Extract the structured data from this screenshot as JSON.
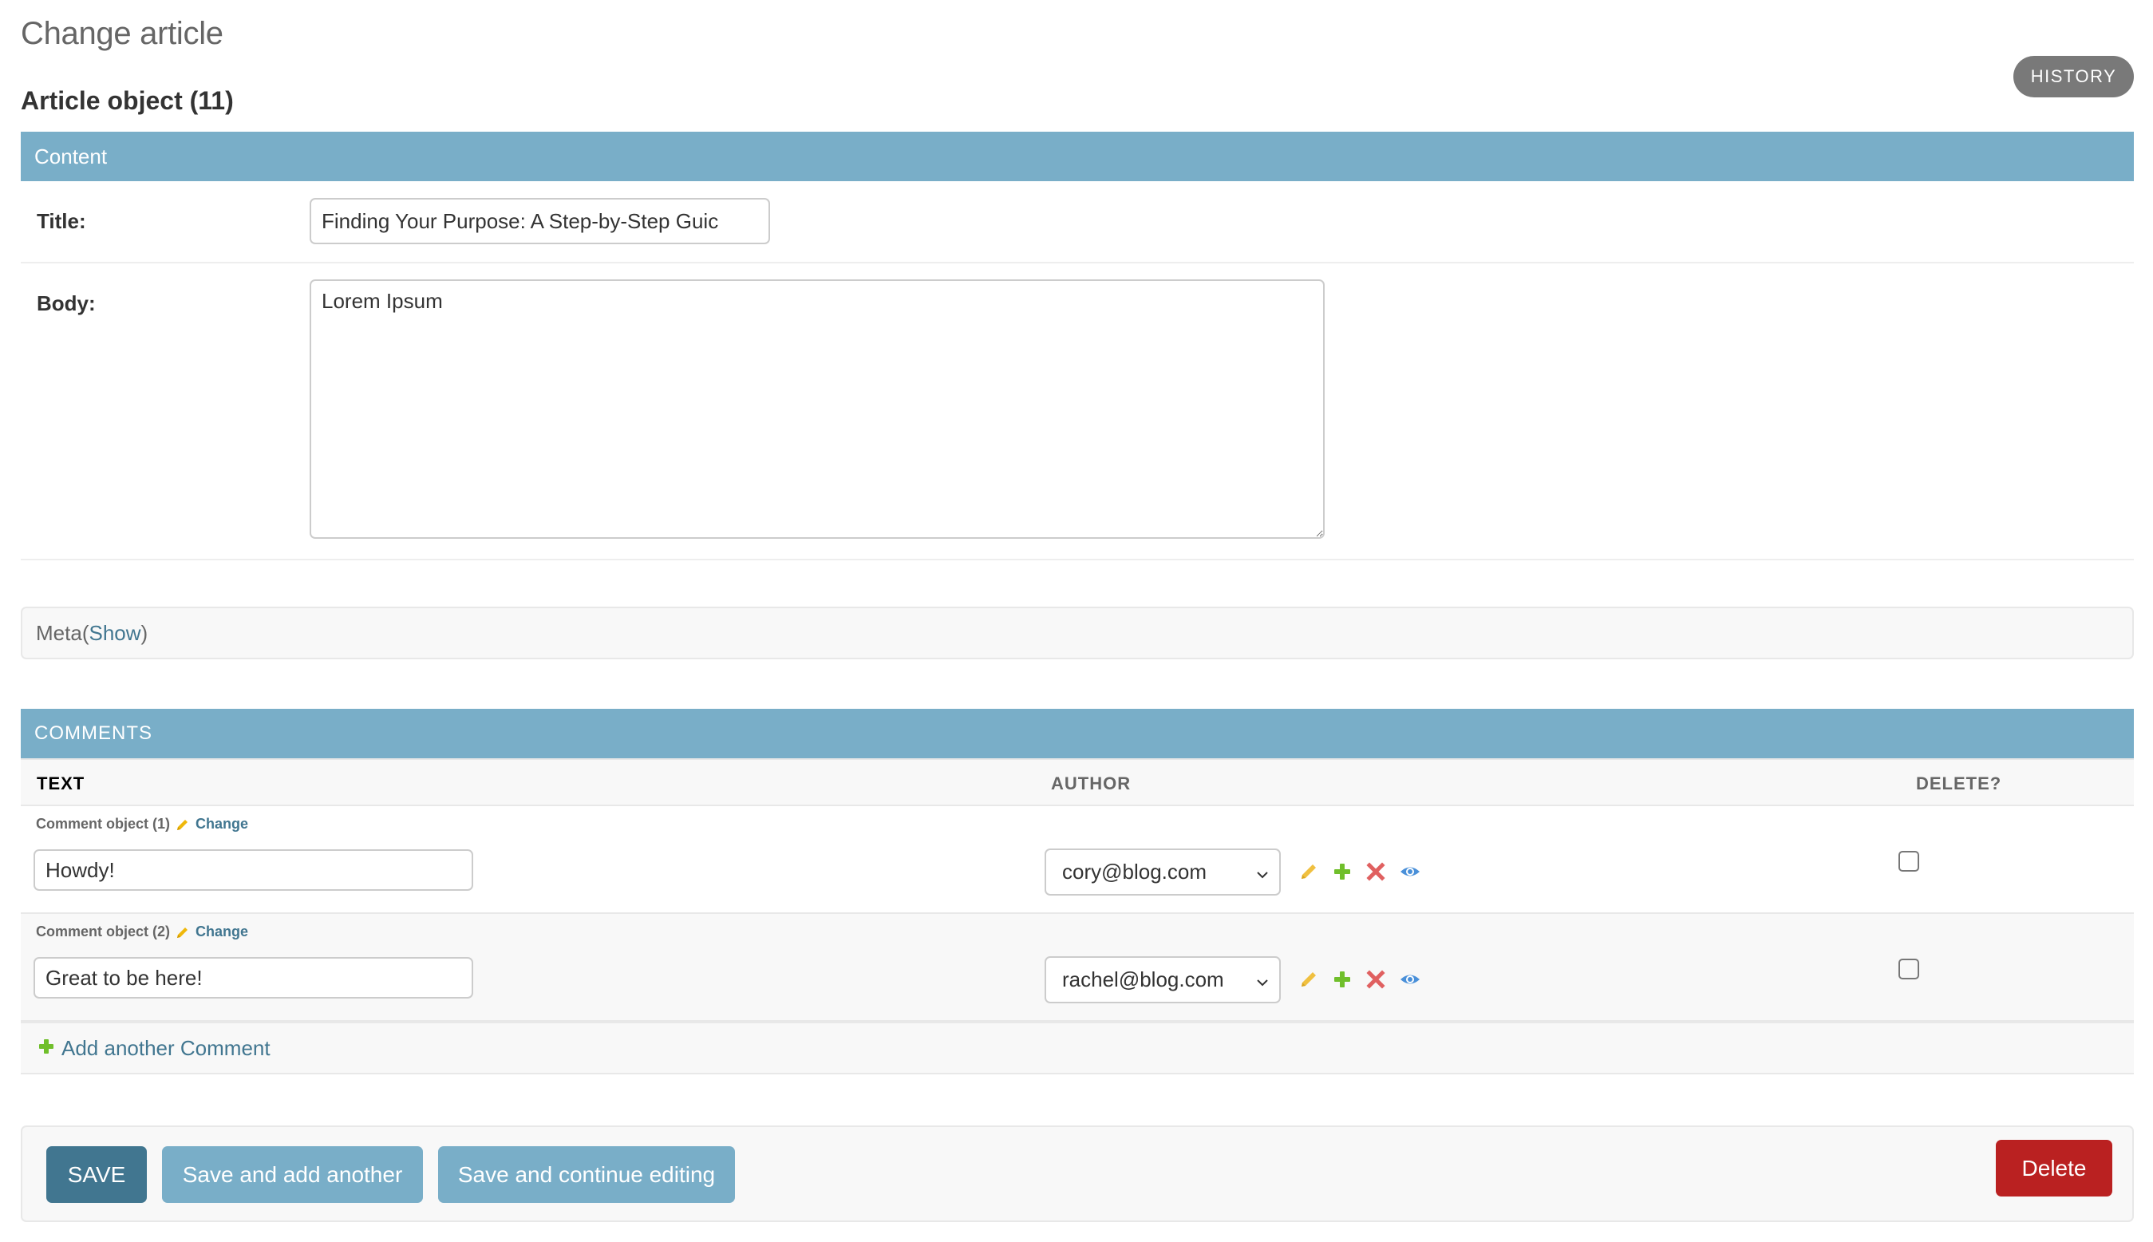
{
  "page": {
    "title": "Change article",
    "object_title": "Article object (11)",
    "history_label": "History"
  },
  "content_section": {
    "header": "Content",
    "fields": {
      "title": {
        "label": "Title:",
        "value": "Finding Your Purpose: A Step-by-Step Guic"
      },
      "body": {
        "label": "Body:",
        "value": "Lorem Ipsum"
      }
    }
  },
  "meta_section": {
    "label": "Meta",
    "open_paren": " (",
    "toggle_label": "Show",
    "close_paren": ")"
  },
  "comments_section": {
    "header": "Comments",
    "columns": {
      "text": "Text",
      "author": "Author",
      "delete": "Delete?"
    },
    "rows": [
      {
        "caption": "Comment object (1)",
        "change_label": "Change",
        "text": "Howdy!",
        "author": "cory@blog.com",
        "delete_checked": false
      },
      {
        "caption": "Comment object (2)",
        "change_label": "Change",
        "text": "Great to be here!",
        "author": "rachel@blog.com",
        "delete_checked": false
      }
    ],
    "add_another_label": "Add another Comment"
  },
  "submit_row": {
    "save": "Save",
    "save_add_another": "Save and add another",
    "save_continue": "Save and continue editing",
    "delete": "Delete"
  },
  "colors": {
    "section_header": "#79aec8",
    "primary_button": "#417690",
    "link": "#417690",
    "delete_button": "#ba2121",
    "history_button": "#797979",
    "pencil_icon": "#efb80b",
    "plus_icon": "#70bf2b",
    "delete_icon": "#dd4646",
    "view_icon": "#447e9b"
  }
}
